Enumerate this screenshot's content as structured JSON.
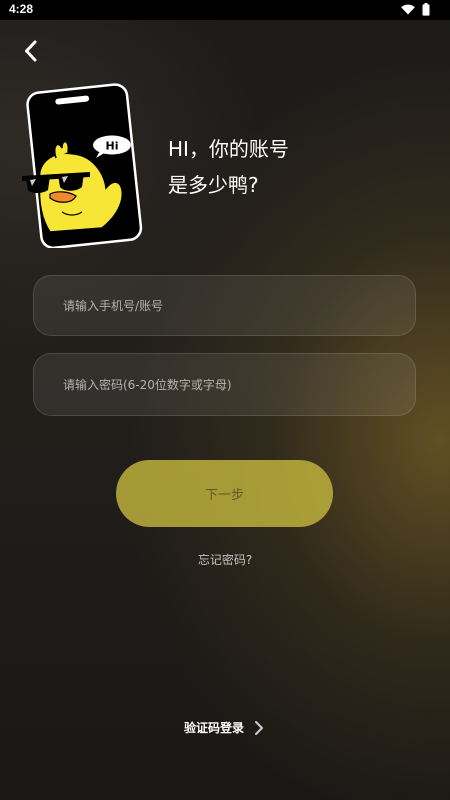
{
  "status_bar": {
    "time": "4:28",
    "icons": [
      "wifi-icon",
      "battery-icon"
    ]
  },
  "header": {
    "back_icon": "chevron-left-icon"
  },
  "mascot": {
    "speech_bubble": "Hi",
    "icon": "duck-phone-mascot"
  },
  "greeting": {
    "line1": "HI，你的账号",
    "line2": "是多少鸭?"
  },
  "form": {
    "account_placeholder": "请输入手机号/账号",
    "account_value": "",
    "password_placeholder": "请输入密码(6-20位数字或字母)",
    "password_value": ""
  },
  "actions": {
    "next_label": "下一步",
    "forgot_label": "忘记密码?",
    "code_login_label": "验证码登录",
    "code_login_icon": "chevron-right-icon"
  },
  "colors": {
    "accent": "#c9bd3f",
    "mascot_yellow": "#f7e636",
    "background": "#1c1b1a"
  }
}
